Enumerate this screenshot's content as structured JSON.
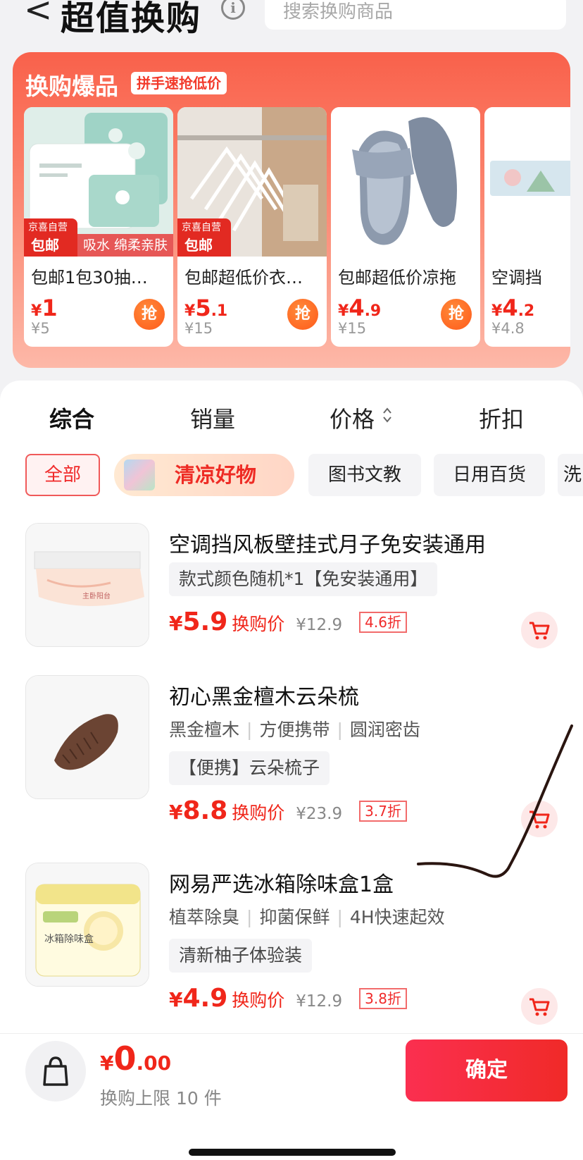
{
  "header": {
    "back_label": "<",
    "title": "超值换购",
    "info_label": "i",
    "search_placeholder": "搜索换购商品"
  },
  "hot_section": {
    "title": "换购爆品",
    "subtitle": "拼手速抢低价",
    "grab_label": "抢",
    "self_badge_line1": "京喜自营",
    "self_badge_line2": "包邮",
    "cards": [
      {
        "name": "包邮1包30抽…",
        "price_yen": "¥",
        "price_int": "1",
        "price_dec": "",
        "orig": "¥5",
        "strip": "吸水  绵柔亲肤",
        "has_grab": true
      },
      {
        "name": "包邮超低价衣…",
        "price_yen": "¥",
        "price_int": "5",
        "price_dec": ".1",
        "orig": "¥15",
        "strip": "",
        "has_grab": true
      },
      {
        "name": "包邮超低价凉拖",
        "price_yen": "¥",
        "price_int": "4",
        "price_dec": ".9",
        "orig": "¥15",
        "strip": "",
        "has_grab": true
      },
      {
        "name": "空调挡",
        "price_yen": "¥",
        "price_int": "4",
        "price_dec": ".2",
        "orig": "¥4.8",
        "strip": "",
        "has_grab": false
      }
    ]
  },
  "sort_tabs": [
    "综合",
    "销量",
    "价格",
    "折扣"
  ],
  "sort_arrows": "⌃\n⌄",
  "filter_chips": [
    "全部",
    "清凉好物",
    "图书文教",
    "日用百货",
    "洗"
  ],
  "products": [
    {
      "title": "空调挡风板壁挂式月子免安装通用",
      "attrs": [],
      "tag": "款式颜色随机*1【免安装通用】",
      "price_yen": "¥",
      "price_value": "5.9",
      "price_label": "换购价",
      "orig": "¥12.9",
      "discount": "4.6折"
    },
    {
      "title": "初心黑金檀木云朵梳",
      "attrs": [
        "黑金檀木",
        "方便携带",
        "圆润密齿"
      ],
      "tag": "【便携】云朵梳子",
      "price_yen": "¥",
      "price_value": "8.8",
      "price_label": "换购价",
      "orig": "¥23.9",
      "discount": "3.7折"
    },
    {
      "title": "网易严选冰箱除味盒1盒",
      "attrs": [
        "植萃除臭",
        "抑菌保鲜",
        "4H快速起效"
      ],
      "tag": "清新柚子体验装",
      "price_yen": "¥",
      "price_value": "4.9",
      "price_label": "换购价",
      "orig": "¥12.9",
      "discount": "3.8折"
    }
  ],
  "product_image_labels": [
    "主卧阳台",
    "冰箱除味盒"
  ],
  "bottom_bar": {
    "total_yen": "¥",
    "total_int": "0",
    "total_dec": ".00",
    "limit_text": "换购上限 10 件",
    "confirm_label": "确定"
  },
  "colors": {
    "accent_red": "#f0261a",
    "hot_bg_top": "#f9614b",
    "confirm_bg": "#fb2f50"
  }
}
